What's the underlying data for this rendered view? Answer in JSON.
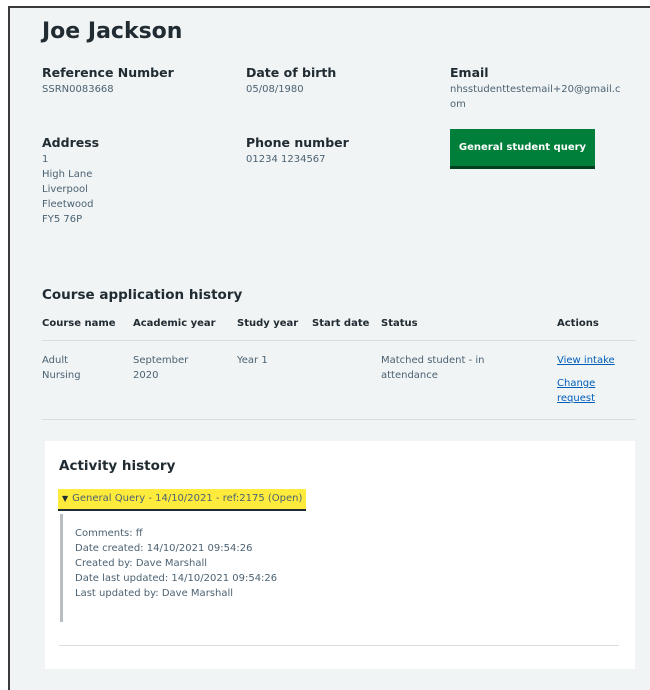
{
  "student": {
    "name": "Joe Jackson",
    "reference_label": "Reference Number",
    "reference_value": "SSRN0083668",
    "dob_label": "Date of birth",
    "dob_value": "05/08/1980",
    "email_label": "Email",
    "email_line1": "nhsstudenttestemail+20@gmail.c",
    "email_line2": "om",
    "address_label": "Address",
    "address_lines": [
      "1",
      "High Lane",
      "Liverpool",
      "Fleetwood",
      "FY5 76P"
    ],
    "phone_label": "Phone number",
    "phone_value": "01234 1234567",
    "query_button": "General student query"
  },
  "course_history": {
    "title": "Course application history",
    "headers": [
      "Course name",
      "Academic year",
      "Study year",
      "Start date",
      "Status",
      "Actions"
    ],
    "row": {
      "course_line1": "Adult",
      "course_line2": "Nursing",
      "academic_line1": "September",
      "academic_line2": "2020",
      "study_year": "Year 1",
      "start_date": "",
      "status_line1": "Matched student - in",
      "status_line2": "attendance",
      "action_view": "View intake",
      "action_change_line1": "Change",
      "action_change_line2": "request"
    }
  },
  "activity": {
    "title": "Activity history",
    "summary": "General Query - 14/10/2021 - ref:2175 (Open)",
    "details": [
      "Comments: ff",
      "Date created: 14/10/2021 09:54:26",
      "Created by: Dave Marshall",
      "Date last updated: 14/10/2021 09:54:26",
      "Last updated by: Dave Marshall"
    ]
  },
  "colors": {
    "page_bg": "#f0f4f5",
    "button_green": "#007f3b",
    "link_blue": "#005eb8",
    "highlight_yellow": "#ffeb3b"
  },
  "icons": {
    "summary_toggle": "triangle-down-icon"
  }
}
